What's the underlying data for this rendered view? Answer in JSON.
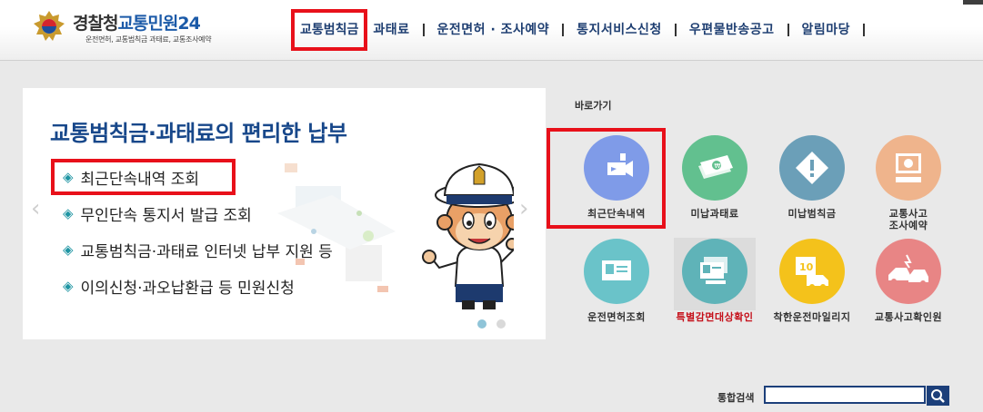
{
  "header": {
    "logo": {
      "title_part1": "경찰청",
      "title_part2": "교통민원24",
      "subtitle": "운전면허, 교통범칙금 과태료, 교통조사예약"
    },
    "nav": [
      {
        "label": "교통범칙금",
        "highlighted": true
      },
      {
        "label": "과태료"
      },
      {
        "label": "운전면허 · 조사예약"
      },
      {
        "label": "통지서비스신청"
      },
      {
        "label": "우편물반송공고"
      },
      {
        "label": "알림마당"
      }
    ]
  },
  "banner": {
    "title": "교통범칙금·과태료의 편리한 납부",
    "items": [
      "최근단속내역 조회",
      "무인단속 통지서 발급 조회",
      "교통범칙금·과태료 인터넷 납부 지원 등",
      "이의신청·과오납환급 등 민원신청"
    ],
    "arrow_left": "‹",
    "arrow_right": "›",
    "page_count": 2,
    "active_page": 1
  },
  "shortcuts": {
    "title": "바로가기",
    "items": [
      {
        "label": "최근단속내역",
        "icon": "camera-icon",
        "color": "#7f9be8"
      },
      {
        "label": "미납과태료",
        "icon": "money-icon",
        "color": "#62c08f"
      },
      {
        "label": "미납범칙금",
        "icon": "warning-icon",
        "color": "#6b9fb8"
      },
      {
        "label": "교통사고\n조사예약",
        "icon": "computer-icon",
        "color": "#efb48c"
      },
      {
        "label": "운전면허조회",
        "icon": "license-card-icon",
        "color": "#6ac3c9"
      },
      {
        "label": "특별감면대상확인",
        "icon": "documents-icon",
        "color": "#5fb3b8"
      },
      {
        "label": "착한운전마일리지",
        "icon": "mileage-icon",
        "color": "#f4c21b"
      },
      {
        "label": "교통사고확인원",
        "icon": "car-crash-icon",
        "color": "#e88585"
      }
    ]
  },
  "search": {
    "label": "통합검색",
    "placeholder": ""
  },
  "colors": {
    "accent": "#e8101a",
    "nav_text": "#1f3f72",
    "title_blue": "#17478a"
  }
}
